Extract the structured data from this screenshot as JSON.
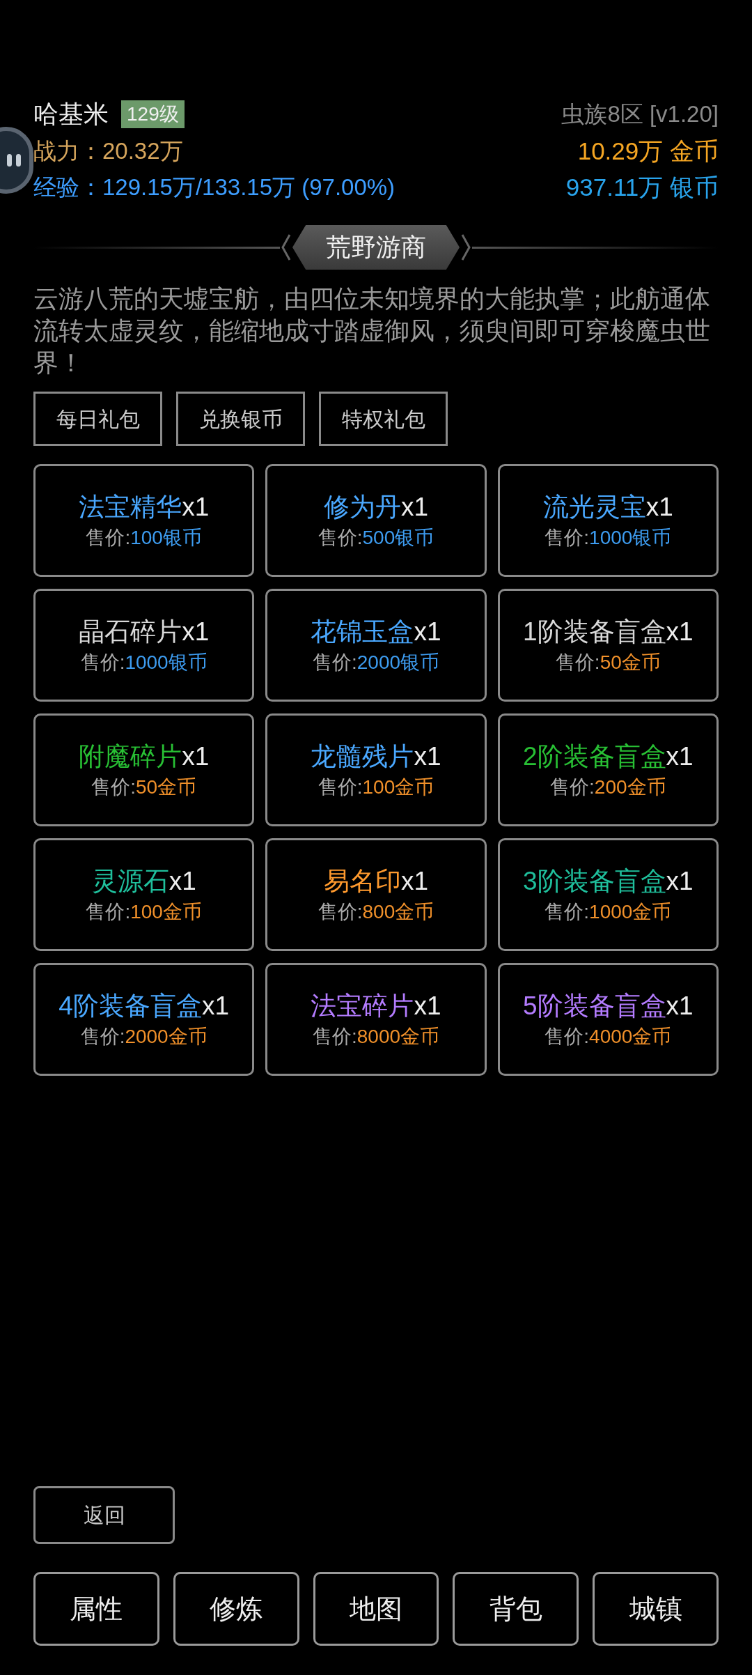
{
  "player": {
    "name": "哈基米",
    "level": "129级",
    "server": "虫族8区 [v1.20]",
    "power": "战力：20.32万",
    "gold": "10.29万 金币",
    "exp": "经验：129.15万/133.15万 (97.00%)",
    "silver": "937.11万 银币"
  },
  "title": "荒野游商",
  "description": "云游八荒的天墟宝舫，由四位未知境界的大能执掌；此舫通体流转太虚灵纹，能缩地成寸踏虚御风，须臾间即可穿梭魔虫世界！",
  "tabs": [
    "每日礼包",
    "兑换银币",
    "特权礼包"
  ],
  "items": [
    {
      "name": "法宝精华",
      "quantity": "x1",
      "color": "#4aa8ff",
      "price_label": "售价:",
      "price": "100银币",
      "kind": "silver"
    },
    {
      "name": "修为丹",
      "quantity": "x1",
      "color": "#4aa8ff",
      "price_label": "售价:",
      "price": "500银币",
      "kind": "silver"
    },
    {
      "name": "流光灵宝",
      "quantity": "x1",
      "color": "#4aa8ff",
      "price_label": "售价:",
      "price": "1000银币",
      "kind": "silver"
    },
    {
      "name": "晶石碎片",
      "quantity": "x1",
      "color": "#d9d9d9",
      "price_label": "售价:",
      "price": "1000银币",
      "kind": "silver"
    },
    {
      "name": "花锦玉盒",
      "quantity": "x1",
      "color": "#4aa8ff",
      "price_label": "售价:",
      "price": "2000银币",
      "kind": "silver"
    },
    {
      "name": "1阶装备盲盒",
      "quantity": "x1",
      "color": "#d9d9d9",
      "price_label": "售价:",
      "price": "50金币",
      "kind": "gold"
    },
    {
      "name": "附魔碎片",
      "quantity": "x1",
      "color": "#28c034",
      "price_label": "售价:",
      "price": "50金币",
      "kind": "gold"
    },
    {
      "name": "龙髓残片",
      "quantity": "x1",
      "color": "#4aa8ff",
      "price_label": "售价:",
      "price": "100金币",
      "kind": "gold"
    },
    {
      "name": "2阶装备盲盒",
      "quantity": "x1",
      "color": "#28c034",
      "price_label": "售价:",
      "price": "200金币",
      "kind": "gold"
    },
    {
      "name": "灵源石",
      "quantity": "x1",
      "color": "#1fbf9c",
      "price_label": "售价:",
      "price": "100金币",
      "kind": "gold"
    },
    {
      "name": "易名印",
      "quantity": "x1",
      "color": "#ff9a2e",
      "price_label": "售价:",
      "price": "800金币",
      "kind": "gold"
    },
    {
      "name": "3阶装备盲盒",
      "quantity": "x1",
      "color": "#1fbf9c",
      "price_label": "售价:",
      "price": "1000金币",
      "kind": "gold"
    },
    {
      "name": "4阶装备盲盒",
      "quantity": "x1",
      "color": "#4aa8ff",
      "price_label": "售价:",
      "price": "2000金币",
      "kind": "gold"
    },
    {
      "name": "法宝碎片",
      "quantity": "x1",
      "color": "#b47cff",
      "price_label": "售价:",
      "price": "8000金币",
      "kind": "gold"
    },
    {
      "name": "5阶装备盲盒",
      "quantity": "x1",
      "color": "#b47cff",
      "price_label": "售价:",
      "price": "4000金币",
      "kind": "gold"
    }
  ],
  "back": "返回",
  "nav": [
    "属性",
    "修炼",
    "地图",
    "背包",
    "城镇"
  ]
}
